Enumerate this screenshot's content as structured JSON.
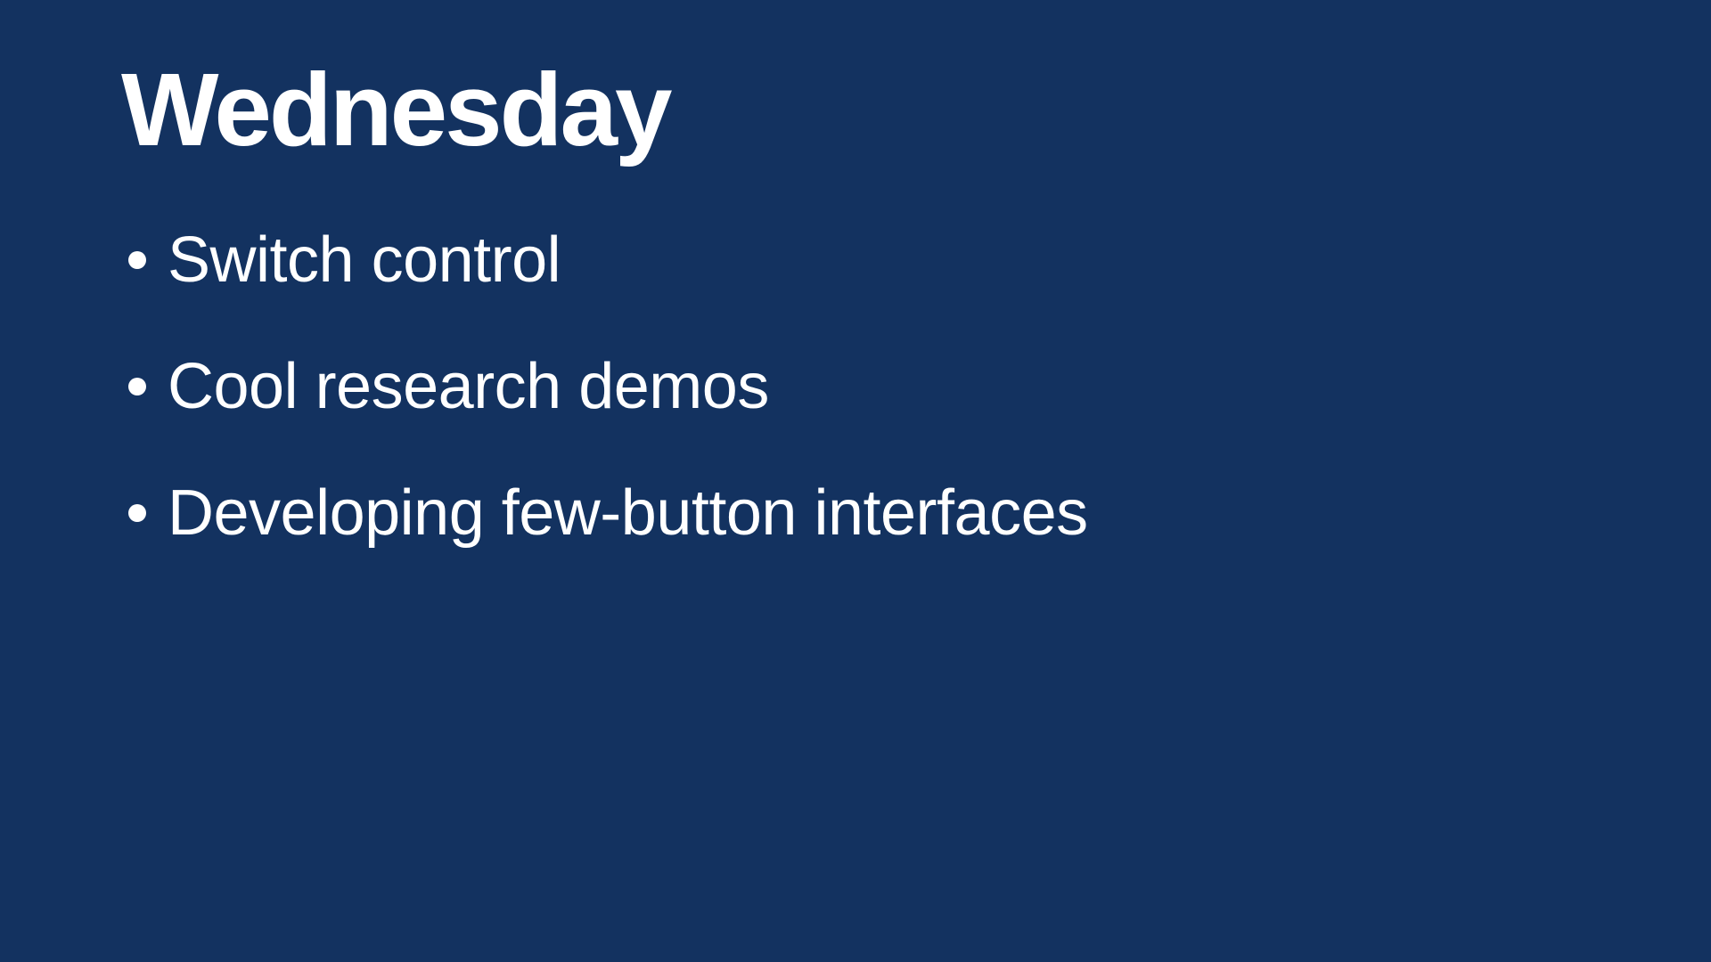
{
  "slide": {
    "title": "Wednesday",
    "bullets": [
      {
        "text": "Switch control"
      },
      {
        "text": "Cool research demos"
      },
      {
        "text": "Developing few-button interfaces"
      }
    ],
    "colors": {
      "background": "#133260",
      "text": "#ffffff"
    }
  }
}
